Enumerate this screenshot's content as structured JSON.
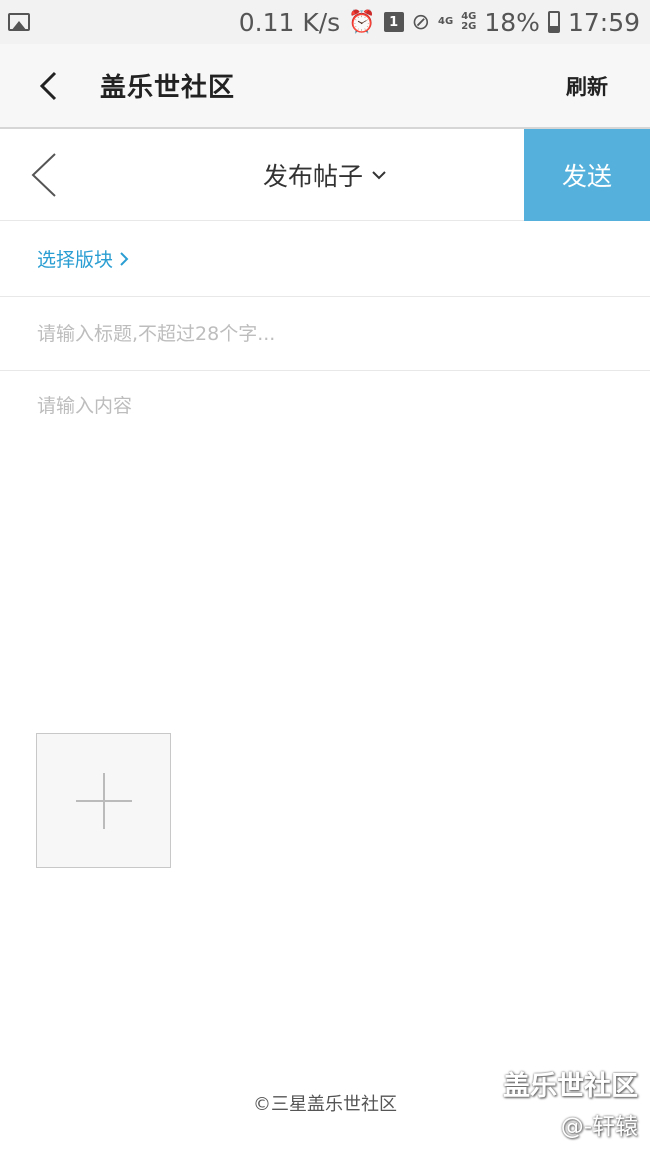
{
  "status_bar": {
    "net_speed": "0.11 K/s",
    "sim_badge": "1",
    "net_4g_a": "4G",
    "net_4g_b": "4G",
    "net_2g": "2G",
    "battery": "18%",
    "time": "17:59",
    "icons": [
      "image-icon",
      "alarm-icon",
      "sim-icon",
      "do-not-disturb-icon",
      "signal-icon",
      "battery-icon"
    ]
  },
  "app_header": {
    "title": "盖乐世社区",
    "refresh_label": "刷新"
  },
  "compose": {
    "title": "发布帖子",
    "send_label": "发送",
    "send_color": "#55b1db"
  },
  "section_picker": {
    "label": "选择版块",
    "color": "#2a9ed2"
  },
  "form": {
    "title_placeholder": "请输入标题,不超过28个字...",
    "content_placeholder": "请输入内容"
  },
  "footer": {
    "copyright": "©三星盖乐世社区"
  },
  "watermark": {
    "brand": "盖乐世社区",
    "user": "@-轩辕"
  }
}
